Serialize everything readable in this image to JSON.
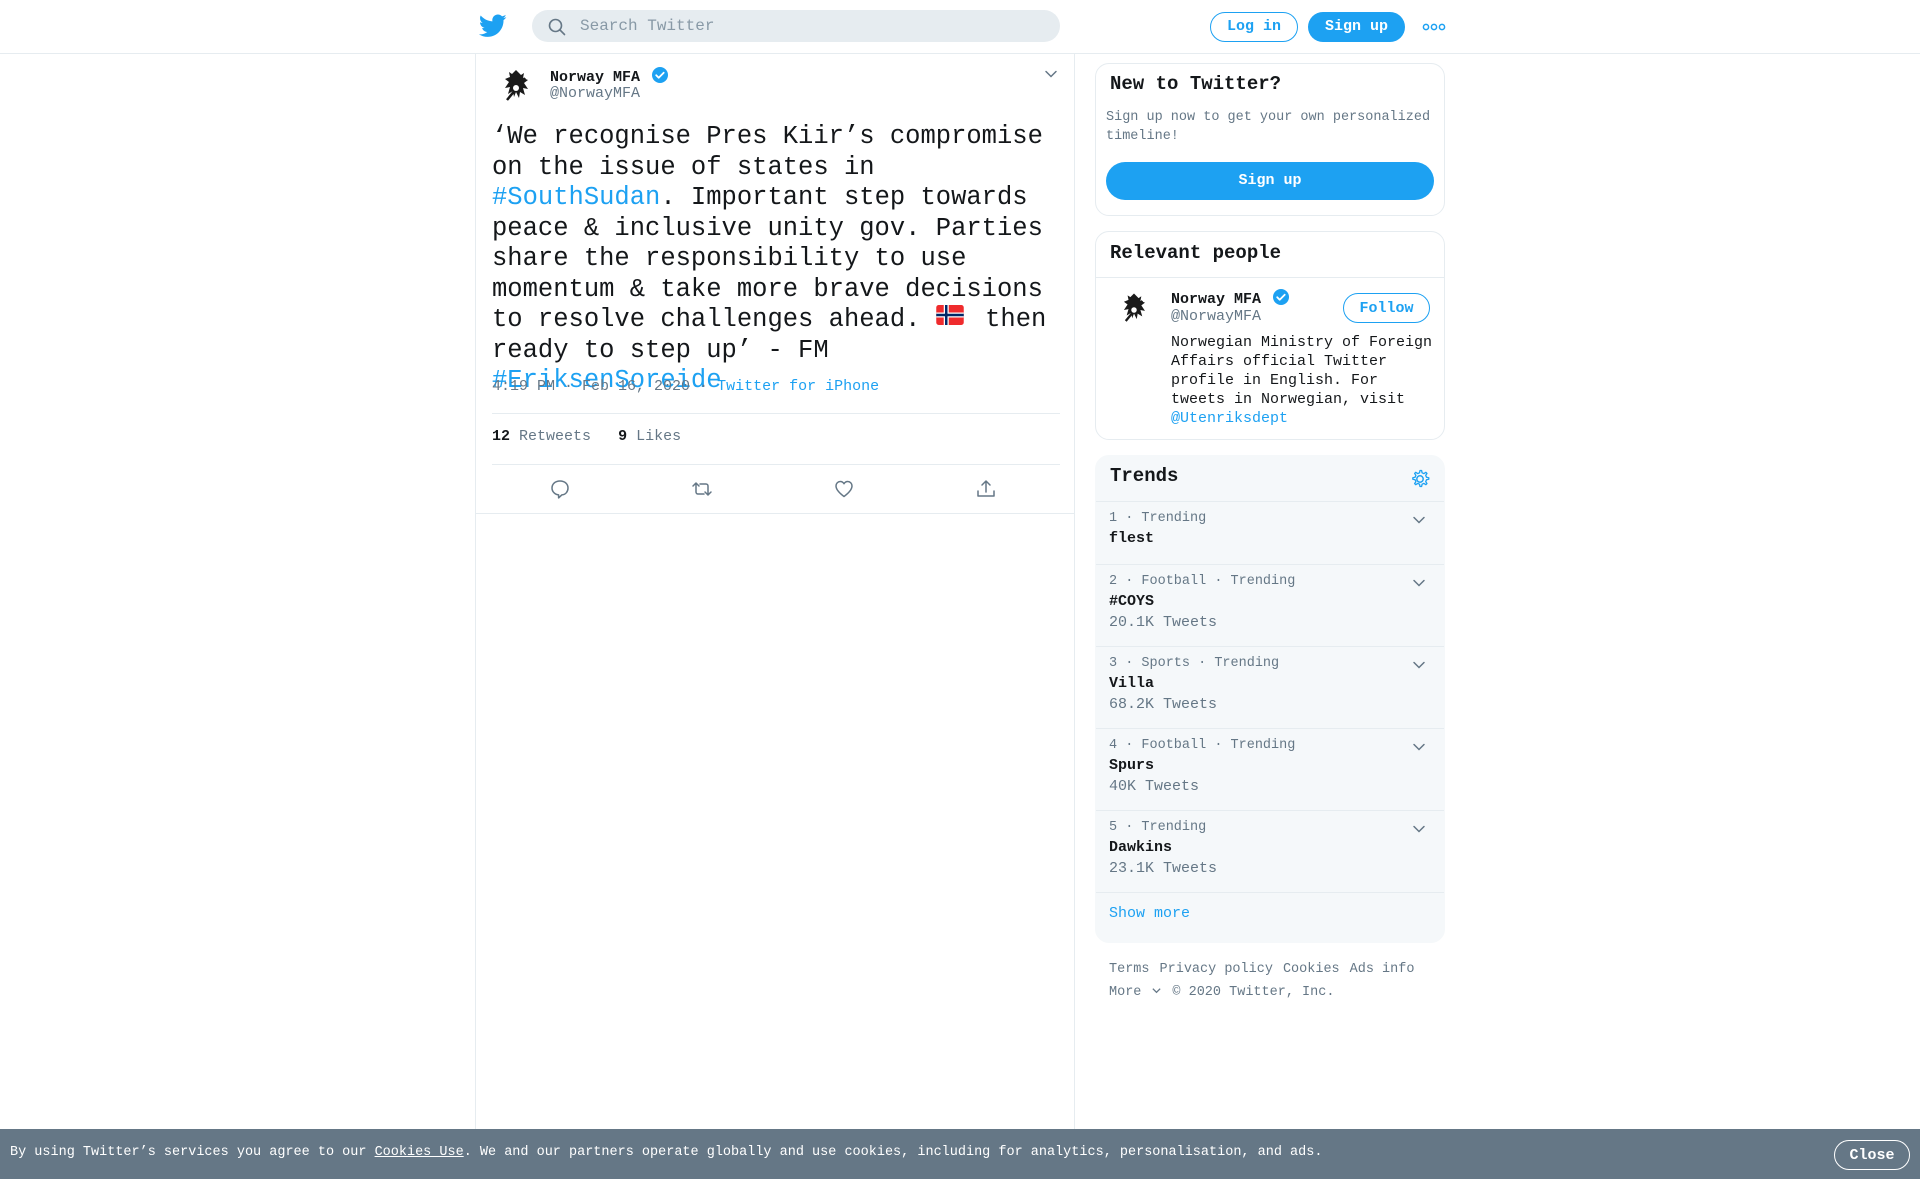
{
  "colors": {
    "accent": "#1da1f2",
    "text": "#14171a",
    "muted": "#657786",
    "border": "#e6ecf0",
    "cookie_bar": "#657786"
  },
  "header": {
    "logo_icon": "twitter-bird-icon",
    "search": {
      "placeholder": "Search Twitter",
      "value": "",
      "icon": "search-icon"
    },
    "login_label": "Log in",
    "signup_label": "Sign up",
    "more_icon": "more-dots-icon"
  },
  "tweet": {
    "author": {
      "name": "Norway MFA",
      "handle": "@NorwayMFA",
      "verified": true,
      "avatar_icon": "norway-coat-of-arms-icon"
    },
    "text": {
      "part1": "‘We recognise Pres Kiir’s compromise on the issue of states in ",
      "hashtag1": "#SouthSudan",
      "part2": ". Important step towards peace & inclusive unity gov. Parties share the responsibility to use momentum & take more brave decisions to resolve challenges ahead. ",
      "flag_icon": "norway-flag-icon",
      "part3": " then ready to step up’ - FM ",
      "hashtag2": "#EriksenSoreide"
    },
    "time": "4:19 PM · Feb 16, 2020",
    "sep": " · ",
    "source": "Twitter for iPhone",
    "retweets": "12",
    "retweets_label": "Retweets",
    "likes": "9",
    "likes_label": "Likes",
    "actions": [
      "reply-icon",
      "retweet-icon",
      "like-icon",
      "share-icon"
    ]
  },
  "sidebar": {
    "new_to_twitter": {
      "title": "New to Twitter?",
      "body": "Sign up now to get your own personalized timeline!",
      "button": "Sign up"
    },
    "relevant_people": {
      "title": "Relevant people",
      "person": {
        "name": "Norway MFA",
        "handle": "@NorwayMFA",
        "follow_label": "Follow",
        "bio": "Norwegian Ministry of Foreign Affairs official Twitter profile in English. For tweets in Norwegian, visit ",
        "bio_link": "@Utenriksdept"
      }
    },
    "trends": {
      "title": "Trends",
      "settings_icon": "gear-icon",
      "items": [
        {
          "context": "1 · Trending",
          "name": "flest",
          "count": ""
        },
        {
          "context": "2 · Football · Trending",
          "name": "#COYS",
          "count": "20.1K Tweets"
        },
        {
          "context": "3 · Sports · Trending",
          "name": "Villa",
          "count": "68.2K Tweets"
        },
        {
          "context": "4 · Football · Trending",
          "name": "Spurs",
          "count": "40K Tweets"
        },
        {
          "context": "5 · Trending",
          "name": "Dawkins",
          "count": "23.1K Tweets"
        }
      ],
      "show_more": "Show more"
    },
    "footer": {
      "terms": "Terms",
      "privacy": "Privacy policy",
      "cookies": "Cookies",
      "ads": "Ads info",
      "more": "More",
      "copyright": "© 2020 Twitter, Inc."
    }
  },
  "cookie_bar": {
    "text_before": "By using Twitter’s services you agree to our ",
    "link": "Cookies Use",
    "text_after": ". We and our partners operate globally and use cookies, including for analytics, personalisation, and ads.",
    "close_label": "Close"
  }
}
